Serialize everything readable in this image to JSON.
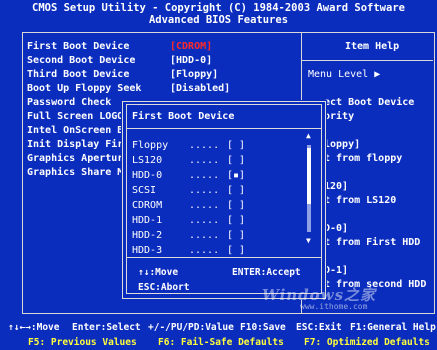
{
  "header": {
    "title": "CMOS Setup Utility - Copyright (C) 1984-2003 Award Software",
    "subtitle": "Advanced BIOS Features"
  },
  "settings": [
    {
      "label": "First Boot Device",
      "value": "[CDROM]",
      "selected": true
    },
    {
      "label": "Second Boot Device",
      "value": "[HDD-0]"
    },
    {
      "label": "Third Boot Device",
      "value": "[Floppy]"
    },
    {
      "label": "Boot Up Floppy Seek",
      "value": "[Disabled]"
    },
    {
      "label": "Password Check",
      "value": ""
    },
    {
      "label": "Full Screen LOGO",
      "value": ""
    },
    {
      "label": "Intel OnScreen Br",
      "value": ""
    },
    {
      "label": "Init Display Firs",
      "value": ""
    },
    {
      "label": "Graphics Aperture",
      "value": ""
    },
    {
      "label": "Graphics Share Me",
      "value": ""
    }
  ],
  "help": {
    "title": "Item Help",
    "menu_level": "Menu Level  ▶",
    "lines": [
      "ect Boot Device",
      "ority",
      "loppy]",
      "t from floppy",
      "120]",
      "t from LS120",
      "D-0]",
      "t from First HDD",
      "D-1]",
      "t from second HDD"
    ]
  },
  "popup": {
    "title": "First Boot Device",
    "options": [
      {
        "name": "Floppy",
        "dots": ".....",
        "box": "[ ]"
      },
      {
        "name": "LS120",
        "dots": ".....",
        "box": "[ ]"
      },
      {
        "name": "HDD-0",
        "dots": ".....",
        "box": "[▪]"
      },
      {
        "name": "SCSI",
        "dots": ".....",
        "box": "[ ]"
      },
      {
        "name": "CDROM",
        "dots": ".....",
        "box": "[ ]"
      },
      {
        "name": "HDD-1",
        "dots": ".....",
        "box": "[ ]"
      },
      {
        "name": "HDD-2",
        "dots": ".....",
        "box": "[ ]"
      },
      {
        "name": "HDD-3",
        "dots": ".....",
        "box": "[ ]"
      }
    ],
    "scroll_up": "▲",
    "scroll_down": "▼",
    "hint_move": "↑↓:Move",
    "hint_accept": "ENTER:Accept",
    "hint_abort": "ESC:Abort"
  },
  "footer": {
    "row1": [
      "↑↓←→:Move",
      "Enter:Select",
      "+/-/PU/PD:Value",
      "F10:Save",
      "ESC:Exit",
      "F1:General Help"
    ],
    "row2": [
      "F5: Previous Values",
      "F6: Fail-Safe Defaults",
      "F7: Optimized Defaults"
    ]
  },
  "watermark": {
    "text": "Windows之家",
    "url": "www.ithome.com"
  },
  "colors": {
    "background": "#0b2dbd",
    "selected_value": "#ff2a2a",
    "footer_highlight": "#ffff3c",
    "frame": "#d8d8d8"
  }
}
